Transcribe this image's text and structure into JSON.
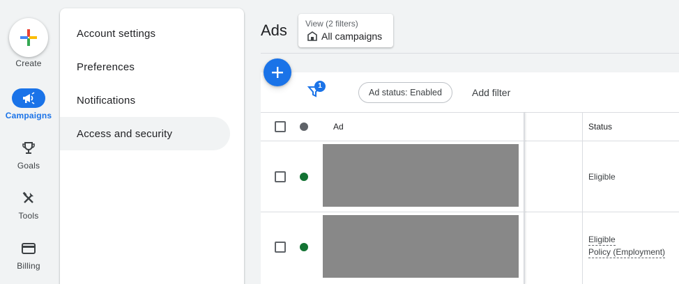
{
  "rail": {
    "create": {
      "label": "Create",
      "icon": "plus-multicolor-icon"
    },
    "items": [
      {
        "label": "Campaigns",
        "icon": "megaphone-icon",
        "active": true
      },
      {
        "label": "Goals",
        "icon": "trophy-icon",
        "active": false
      },
      {
        "label": "Tools",
        "icon": "tools-icon",
        "active": false
      },
      {
        "label": "Billing",
        "icon": "credit-card-icon",
        "active": false
      }
    ]
  },
  "settings_menu": {
    "items": [
      {
        "label": "Account settings",
        "active": false
      },
      {
        "label": "Preferences",
        "active": false
      },
      {
        "label": "Notifications",
        "active": false
      },
      {
        "label": "Access and security",
        "active": true
      }
    ]
  },
  "main": {
    "title": "Ads",
    "view": {
      "subtitle": "View (2 filters)",
      "label": "All campaigns",
      "icon": "building-icon"
    },
    "toolbar": {
      "filter_count": "1",
      "status_chip": "Ad status: Enabled",
      "add_filter": "Add filter"
    },
    "table": {
      "headers": {
        "ad": "Ad",
        "status": "Status"
      },
      "rows": [
        {
          "status": "Eligible",
          "policy": "",
          "status_color": "#137333"
        },
        {
          "status": "Eligible",
          "policy": "Policy (Employment)",
          "status_color": "#137333"
        }
      ]
    }
  },
  "colors": {
    "accent": "#1a73e8",
    "eligible": "#137333",
    "placeholder": "#888888"
  }
}
